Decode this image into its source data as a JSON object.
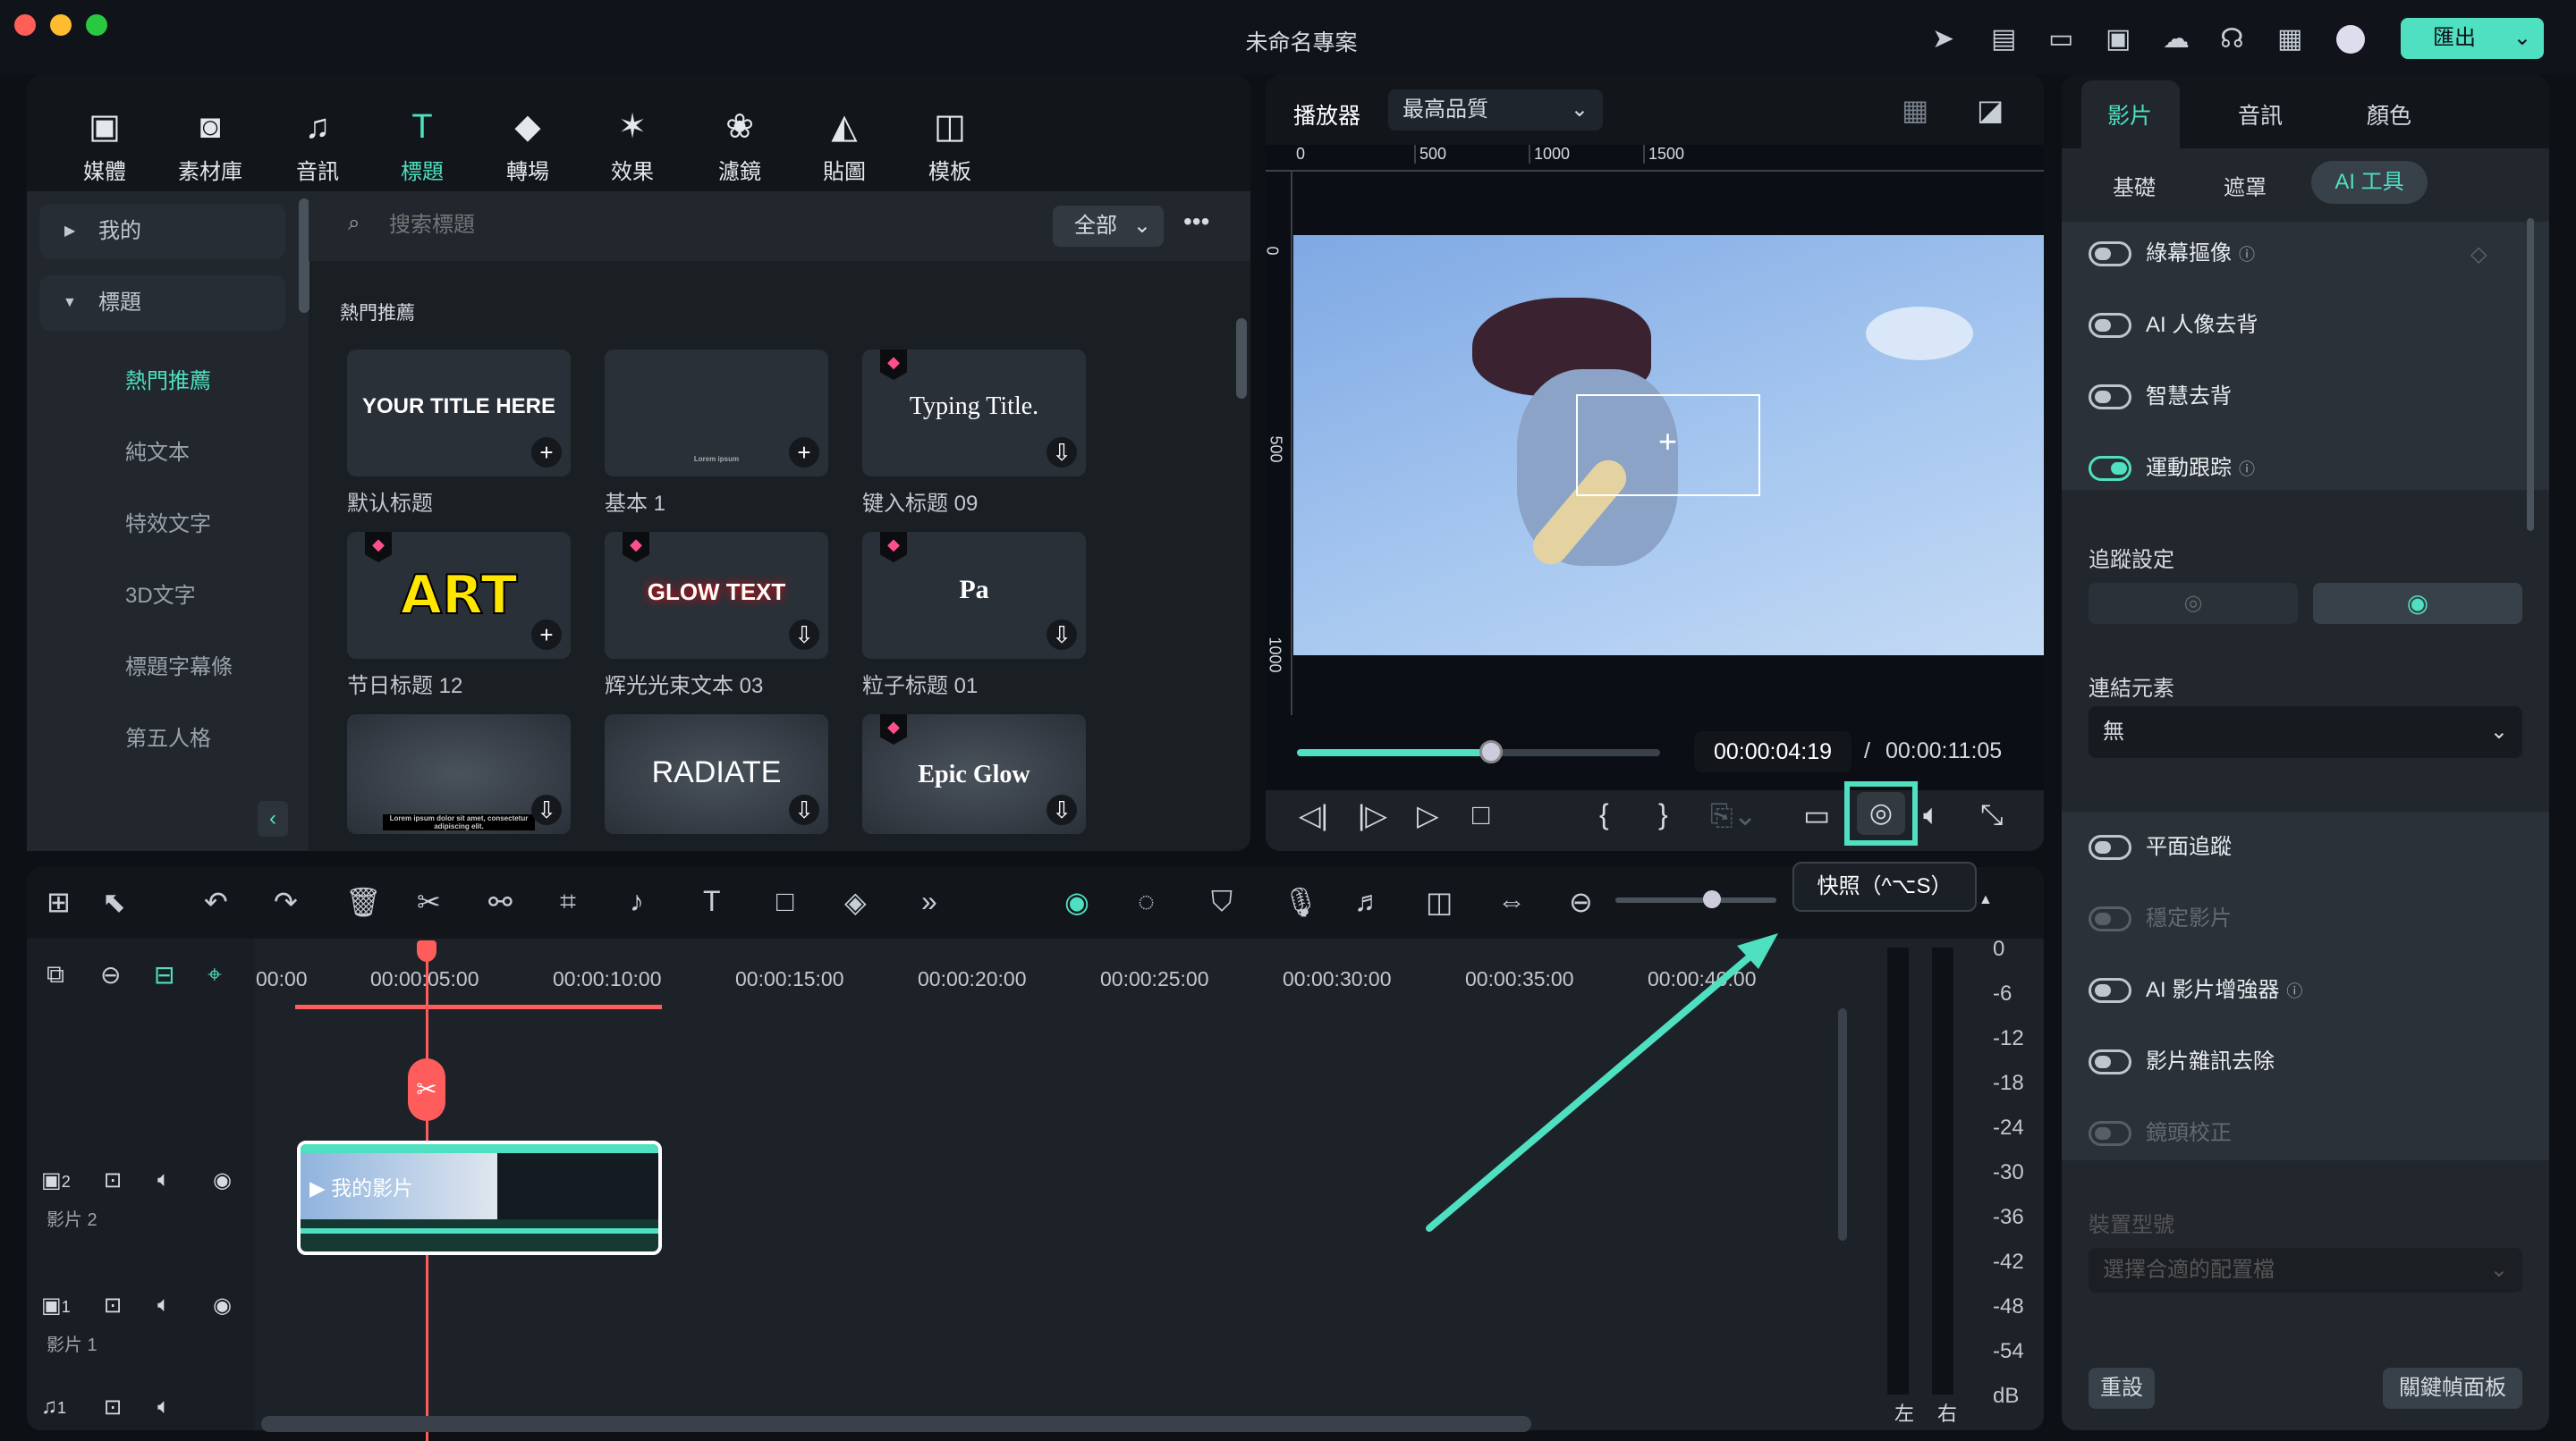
{
  "window": {
    "title": "未命名專案",
    "export_label": "匯出"
  },
  "titlebar_icons": [
    "send-icon",
    "task-icon",
    "layout-icon",
    "save-icon",
    "cloud-icon",
    "headset-icon",
    "grid-icon",
    "avatar"
  ],
  "toolbar": [
    {
      "label": "媒體",
      "icon": "▣"
    },
    {
      "label": "素材庫",
      "icon": "◙"
    },
    {
      "label": "音訊",
      "icon": "♫"
    },
    {
      "label": "標題",
      "icon": "T"
    },
    {
      "label": "轉場",
      "icon": "◆"
    },
    {
      "label": "效果",
      "icon": "✶"
    },
    {
      "label": "濾鏡",
      "icon": "❀"
    },
    {
      "label": "貼圖",
      "icon": "◭"
    },
    {
      "label": "模板",
      "icon": "◫"
    }
  ],
  "sidebar": {
    "groups": [
      {
        "label": "我的",
        "expanded": false
      },
      {
        "label": "標題",
        "expanded": true
      }
    ],
    "items": [
      "熱門推薦",
      "純文本",
      "特效文字",
      "3D文字",
      "標題字幕條",
      "第五人格"
    ],
    "active": "熱門推薦"
  },
  "search": {
    "placeholder": "搜索標題",
    "filter": "全部"
  },
  "section_title": "熱門推薦",
  "cards": [
    {
      "label": "默认标题",
      "preview": "YOUR TITLE HERE",
      "action": "add",
      "premium": false
    },
    {
      "label": "基本 1",
      "preview": "Lorem ipsum",
      "action": "add",
      "premium": false
    },
    {
      "label": "键入标题 09",
      "preview": "Typing Title.",
      "action": "download",
      "premium": true
    },
    {
      "label": "节日标题 12",
      "preview": "ART",
      "action": "add",
      "premium": true
    },
    {
      "label": "辉光光束文本 03",
      "preview": "GLOW TEXT",
      "action": "download",
      "premium": true
    },
    {
      "label": "粒子标题 01",
      "preview": "Pa",
      "action": "download",
      "premium": true
    },
    {
      "label": "",
      "preview": "Lorem ipsum dolor sit amet, consectetur adipiscing elit.",
      "action": "download",
      "premium": false
    },
    {
      "label": "",
      "preview": "RADIATE",
      "action": "download",
      "premium": false
    },
    {
      "label": "",
      "preview": "Epic Glow",
      "action": "download",
      "premium": true
    }
  ],
  "player": {
    "label": "播放器",
    "quality": "最高品質",
    "ruler_h": [
      "0",
      "500",
      "1000",
      "1500"
    ],
    "ruler_v": [
      "0",
      "500",
      "1000"
    ],
    "progress": 0.42,
    "current_time": "00:00:04:19",
    "separator": "/",
    "total_time": "00:00:11:05",
    "tooltip": "快照（^⌥S）"
  },
  "right_panel": {
    "tabs": [
      "影片",
      "音訊",
      "顏色"
    ],
    "active_tab": "影片",
    "subtabs": [
      "基礎",
      "遮罩",
      "AI 工具"
    ],
    "active_subtab": "AI 工具",
    "toggles1": [
      {
        "label": "綠幕摳像",
        "on": false,
        "help": true
      },
      {
        "label": "AI 人像去背",
        "on": false
      },
      {
        "label": "智慧去背",
        "on": false
      },
      {
        "label": "運動跟踪",
        "on": true,
        "help": true
      }
    ],
    "tracking_label": "追蹤設定",
    "link_label": "連結元素",
    "link_value": "無",
    "toggles2": [
      {
        "label": "平面追蹤",
        "on": false
      },
      {
        "label": "穩定影片",
        "on": false,
        "disabled": true
      },
      {
        "label": "AI 影片增強器",
        "on": false,
        "help": true
      },
      {
        "label": "影片雜訊去除",
        "on": false
      },
      {
        "label": "鏡頭校正",
        "on": false,
        "disabled": true
      }
    ],
    "device_label": "裝置型號",
    "device_placeholder": "選擇合適的配置檔",
    "reset": "重設",
    "keyframe": "關鍵幀面板"
  },
  "timeline": {
    "ruler": [
      "00:00",
      "00:00:05:00",
      "00:00:10:00",
      "00:00:15:00",
      "00:00:20:00",
      "00:00:25:00",
      "00:00:30:00",
      "00:00:35:00",
      "00:00:40:00"
    ],
    "tracks": [
      {
        "num": "2",
        "name": "影片 2"
      },
      {
        "num": "1",
        "name": "影片 1"
      },
      {
        "num": "1",
        "name": ""
      }
    ],
    "clip_label": "我的影片",
    "zoom": 0.6
  },
  "meter": {
    "scale": [
      "0",
      "-6",
      "-12",
      "-18",
      "-24",
      "-30",
      "-36",
      "-42",
      "-48",
      "-54",
      "dB"
    ],
    "channels": [
      "左",
      "右"
    ]
  },
  "colors": {
    "accent": "#4ee0c0",
    "playhead": "#ff5c5c",
    "premium": "#ff4f8b"
  }
}
